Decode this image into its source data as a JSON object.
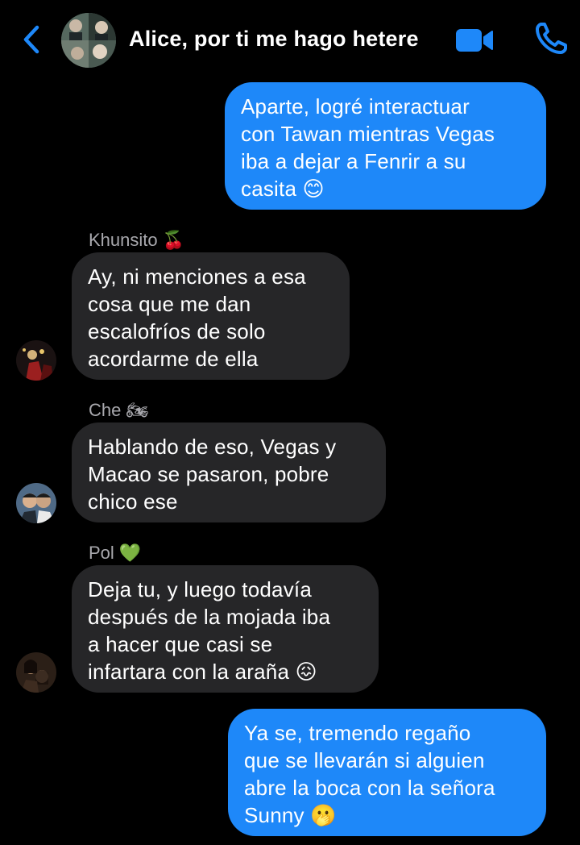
{
  "header": {
    "title": "Alice, por ti me hago hetere",
    "back_icon": "chevron-left-icon",
    "video_icon": "video-camera-icon",
    "phone_icon": "phone-icon",
    "accent_color": "#1e88f9"
  },
  "messages": [
    {
      "direction": "outgoing",
      "text": "Aparte, logré interactuar\ncon Tawan mientras Vegas\niba a dejar a Fenrir a su\ncasita 😊"
    },
    {
      "direction": "incoming",
      "sender": "Khunsito 🍒",
      "text": "Ay, ni menciones a esa\ncosa que me dan\nescalofríos de solo\nacordarme de ella"
    },
    {
      "direction": "incoming",
      "sender": "Che 🏍",
      "text": "Hablando de eso, Vegas y\nMacao se pasaron, pobre\nchico ese"
    },
    {
      "direction": "incoming",
      "sender": "Pol 💚",
      "text": "Deja tu, y luego todavía\ndespués de la mojada iba\na hacer que casi se\ninfartara con la araña 😖"
    },
    {
      "direction": "outgoing",
      "text": "Ya se, tremendo regaño\nque se llevarán si alguien\nabre la boca con la señora\nSunny 🫢"
    }
  ]
}
